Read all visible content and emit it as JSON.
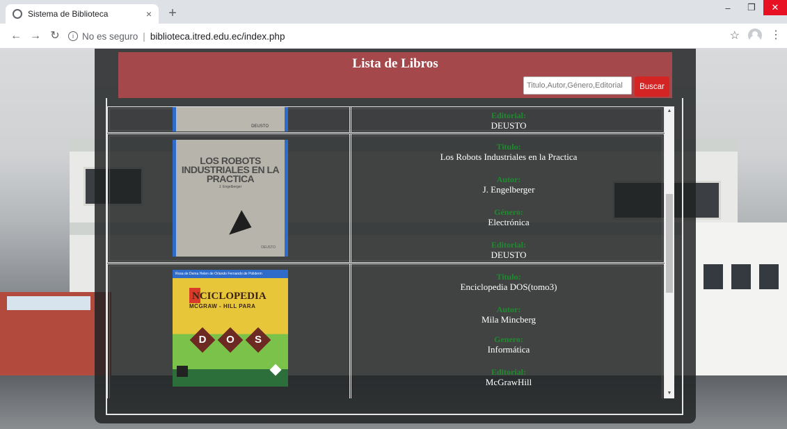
{
  "browser": {
    "tab_title": "Sistema de Biblioteca",
    "tab_close": "×",
    "new_tab": "+",
    "security_label": "No es seguro",
    "url": "biblioteca.itred.edu.ec/index.php"
  },
  "page": {
    "header_title": "Lista de Libros",
    "search_placeholder": "Titulo,Autor,Género,Editorial",
    "search_button": "Buscar"
  },
  "books": [
    {
      "cover_text": "DEUSTO",
      "fields": [
        {
          "label": "Editorial:",
          "value": "DEUSTO"
        }
      ]
    },
    {
      "cover_title": "LOS ROBOTS INDUSTRIALES EN LA PRACTICA",
      "cover_sub": "J. Engelberger",
      "cover_pub": "DEUSTO",
      "fields": [
        {
          "label": "Titulo:",
          "value": "Los Robots Industriales en la Practica"
        },
        {
          "label": "Autor:",
          "value": "J. Engelberger"
        },
        {
          "label": "Género:",
          "value": "Electrónica"
        },
        {
          "label": "Editorial:",
          "value": "DEUSTO"
        }
      ]
    },
    {
      "cover_strip": "Rosa de Dema  Helen de Orlando  Fernando de Poliderm",
      "cover_title": "NCICLOPEDIA",
      "cover_sub": "MCGRAW - HILL PARA",
      "cover_letters": [
        "D",
        "O",
        "S"
      ],
      "fields": [
        {
          "label": "Titulo:",
          "value": "Enciclopedia DOS(tomo3)"
        },
        {
          "label": "Autor:",
          "value": "Mila Mincberg"
        },
        {
          "label": "Genero:",
          "value": "Informática"
        },
        {
          "label": "Editorial:",
          "value": "McGrawHill"
        }
      ]
    }
  ]
}
